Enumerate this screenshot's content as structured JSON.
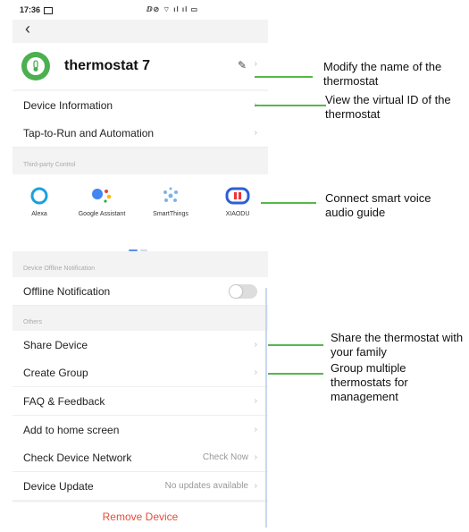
{
  "status_bar": {
    "time": "17:36",
    "icons": "ⅅ⊘ ⌔ ıl ıl ▭"
  },
  "device": {
    "name": "thermostat 7"
  },
  "rows": {
    "device_info": "Device Information",
    "tap_to_run": "Tap-to-Run and Automation",
    "offline_notification": "Offline Notification",
    "share_device": "Share Device",
    "create_group": "Create Group",
    "faq": "FAQ & Feedback",
    "add_home": "Add to home screen",
    "check_network": "Check Device Network",
    "check_network_value": "Check Now",
    "device_update": "Device Update",
    "device_update_value": "No updates available"
  },
  "sections": {
    "third_party": "Third-party Control",
    "offline": "Device Offline Notification",
    "others": "Others"
  },
  "services": [
    {
      "name": "Alexa"
    },
    {
      "name": "Google Assistant"
    },
    {
      "name": "SmartThings"
    },
    {
      "name": "XIAODU"
    }
  ],
  "remove_label": "Remove Device",
  "annotations": {
    "modify_name": "Modify the name of the thermostat",
    "virtual_id": "View the virtual ID of the thermostat",
    "voice": "Connect smart voice audio guide",
    "share": "Share the thermostat with your family",
    "group": "Group multiple thermostats for management"
  },
  "colors": {
    "accent_green": "#4caf50",
    "annotation_line": "#55b84a",
    "remove_red": "#e74c3c"
  }
}
